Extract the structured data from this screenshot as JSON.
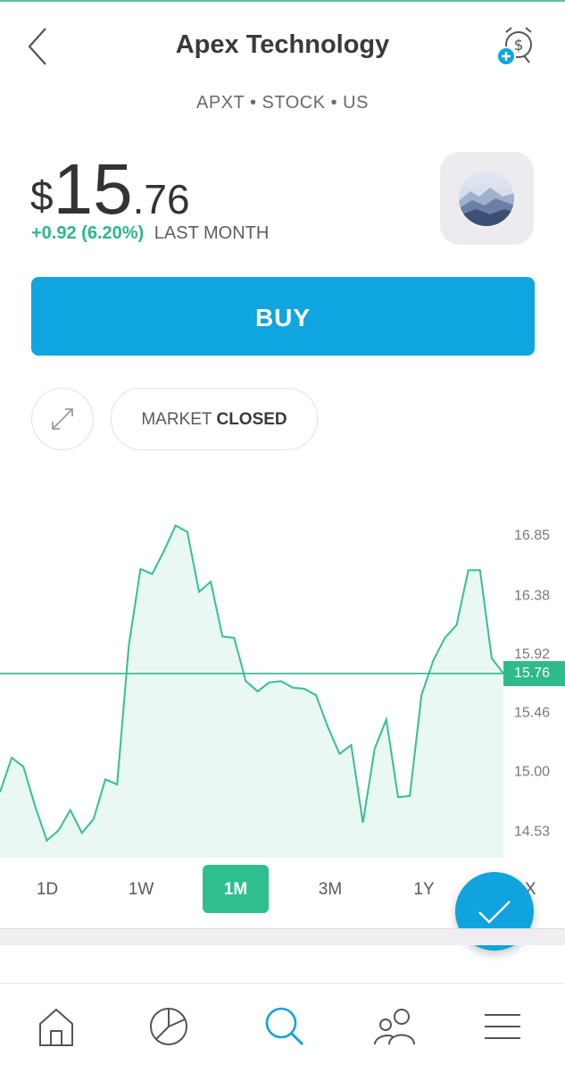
{
  "header": {
    "title": "Apex Technology",
    "subtitle": "APXT • STOCK • US"
  },
  "icons": {
    "back": "chevron-left-icon",
    "alert": "price-alert-clock-icon",
    "logo": "mountain-logo-icon",
    "expand": "expand-icon",
    "fab": "checkmark-icon"
  },
  "quote": {
    "currency": "$",
    "price_int": "15",
    "price_dec": ".76",
    "change": "+0.92 (6.20%)",
    "period": "LAST MONTH"
  },
  "buy_label": "BUY",
  "market": {
    "prefix": "MARKET",
    "status": "CLOSED"
  },
  "chart_data": {
    "type": "area",
    "ylim": [
      14.4,
      17.3
    ],
    "y_ticks": [
      "16.85",
      "16.38",
      "15.92",
      "15.46",
      "15.00",
      "14.53"
    ],
    "y_tick_values": [
      16.85,
      16.38,
      15.92,
      15.46,
      15.0,
      14.53
    ],
    "current_label": "15.76",
    "current_value": 15.76,
    "values": [
      14.83,
      15.1,
      15.03,
      14.72,
      14.45,
      14.53,
      14.69,
      14.51,
      14.62,
      14.93,
      14.89,
      15.98,
      16.58,
      16.54,
      16.72,
      16.92,
      16.87,
      16.4,
      16.48,
      16.05,
      16.04,
      15.7,
      15.62,
      15.69,
      15.7,
      15.65,
      15.64,
      15.59,
      15.34,
      15.13,
      15.2,
      14.59,
      15.17,
      15.4,
      14.79,
      14.8,
      15.59,
      15.86,
      16.04,
      16.14,
      16.57,
      16.57,
      15.88,
      15.76
    ],
    "line_color": "#35bf95",
    "fill_color": "#e9f8f2"
  },
  "ranges": {
    "items": [
      {
        "label": "1D"
      },
      {
        "label": "1W"
      },
      {
        "label": "1M"
      },
      {
        "label": "3M"
      },
      {
        "label": "1Y"
      },
      {
        "label": "MAX"
      }
    ],
    "selected": "1M"
  },
  "nav": {
    "items": [
      {
        "icon": "home-icon"
      },
      {
        "icon": "portfolio-pie-icon"
      },
      {
        "icon": "search-icon",
        "active": true
      },
      {
        "icon": "people-icon"
      },
      {
        "icon": "menu-icon"
      }
    ]
  },
  "colors": {
    "accent_blue": "#0ea5e0",
    "accent_green": "#2fbf8f"
  }
}
